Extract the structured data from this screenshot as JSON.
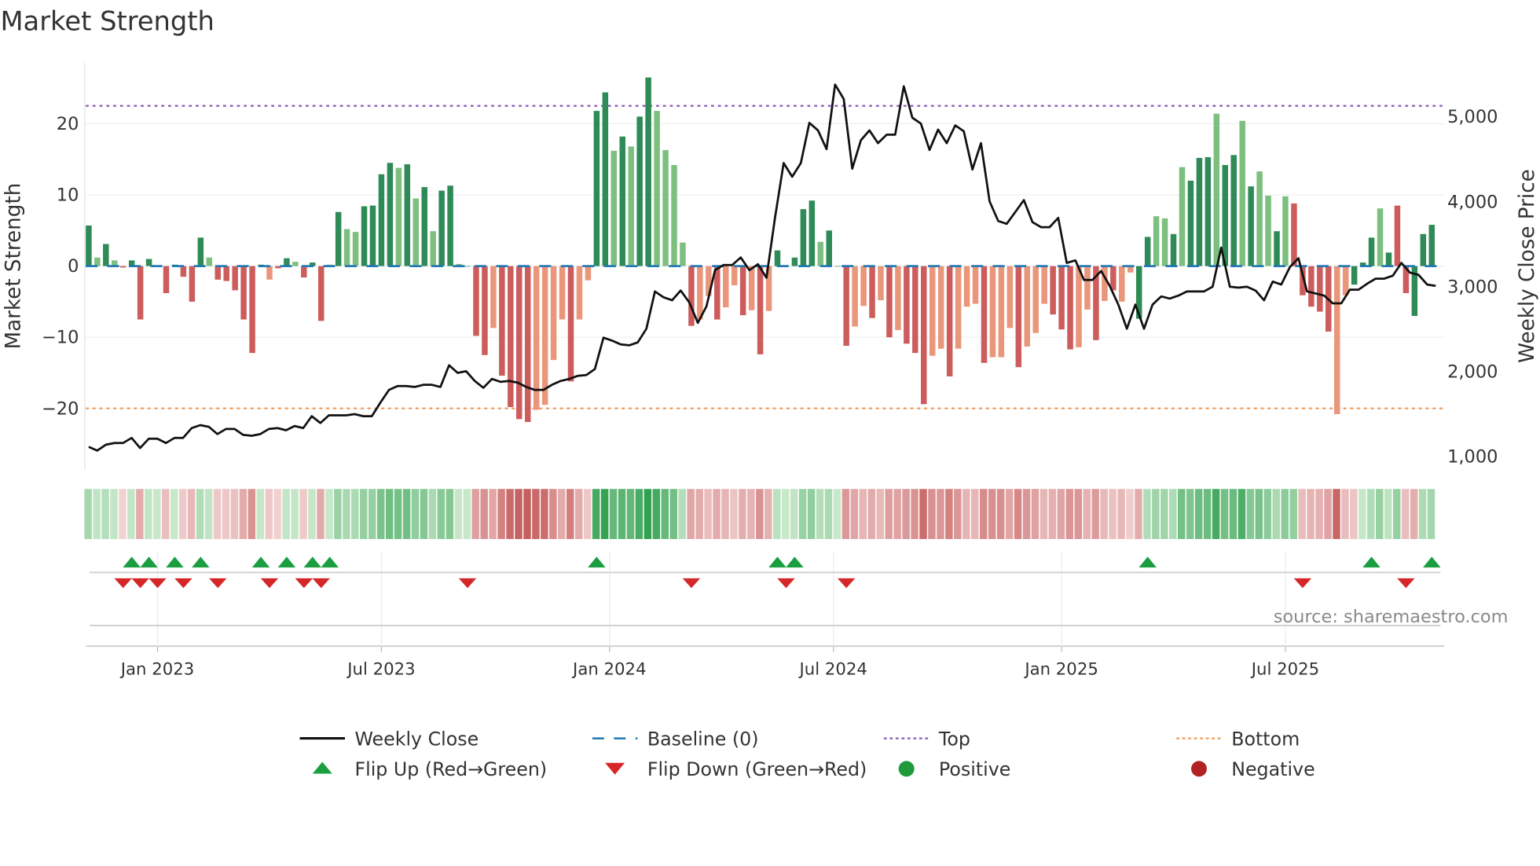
{
  "title": "Market Strength",
  "source": "source: sharemaestro.com",
  "colors": {
    "pos_strong": "#2e8b57",
    "pos_weak": "#7dbf7e",
    "neg_strong": "#cd5c5c",
    "neg_weak": "#e9967a",
    "top": "#9467bd",
    "bottom": "#f4a261",
    "baseline": "#1f77b4",
    "flip_up": "#1a9e3f",
    "flip_down": "#d62728",
    "line": "#111111"
  },
  "chart_data": {
    "type": "bar",
    "title": "Market Strength",
    "ylabel": "Market Strength",
    "y2label": "Weekly Close Price",
    "ylim": [
      -28,
      28
    ],
    "y2lim": [
      800,
      5700
    ],
    "yticks": [
      {
        "v": 20,
        "label": "20"
      },
      {
        "v": 10,
        "label": "10"
      },
      {
        "v": 0,
        "label": "0"
      },
      {
        "v": -10,
        "label": "−10"
      },
      {
        "v": -20,
        "label": "−20"
      }
    ],
    "y2ticks": [
      {
        "v": 5000,
        "label": "5,000"
      },
      {
        "v": 4000,
        "label": "4,000"
      },
      {
        "v": 3000,
        "label": "3,000"
      },
      {
        "v": 2000,
        "label": "2,000"
      },
      {
        "v": 1000,
        "label": "1,000"
      }
    ],
    "xticks": [
      {
        "week": 8,
        "label": "Jan 2023"
      },
      {
        "week": 34,
        "label": "Jul 2023"
      },
      {
        "week": 60.5,
        "label": "Jan 2024"
      },
      {
        "week": 86.5,
        "label": "Jul 2024"
      },
      {
        "week": 113,
        "label": "Jan 2025"
      },
      {
        "week": 139,
        "label": "Jul 2025"
      }
    ],
    "top_level": 22.5,
    "bottom_level": -20,
    "strength": [
      5.7,
      1.2,
      3.1,
      0.8,
      -0.2,
      0.8,
      -7.5,
      1.0,
      0,
      -3.8,
      0.2,
      -1.5,
      -5,
      4,
      1.2,
      -1.9,
      -2.1,
      -3.4,
      -7.5,
      -12.2,
      0.2,
      -1.9,
      -0.3,
      1.1,
      0.6,
      -1.6,
      0.5,
      -7.7,
      0.2,
      7.6,
      5.2,
      4.8,
      8.4,
      8.5,
      12.9,
      14.5,
      13.8,
      14.3,
      9.5,
      11.1,
      4.9,
      10.6,
      11.3,
      0.3,
      0,
      -9.8,
      -12.5,
      -8.7,
      -15.4,
      -19.8,
      -21.5,
      -21.9,
      -20.2,
      -19.5,
      -13.2,
      -7.5,
      -16.2,
      -7.5,
      -2,
      21.8,
      24.4,
      16.2,
      18.2,
      16.8,
      21,
      26.5,
      21.8,
      16.3,
      14.2,
      3.3,
      -8.4,
      -7.5,
      -4.2,
      -7.5,
      -5.8,
      -2.7,
      -6.9,
      -6.2,
      -12.4,
      -6.3,
      2.2,
      0,
      1.2,
      8,
      9.2,
      3.4,
      5,
      0,
      -11.2,
      -8.5,
      -5.6,
      -7.3,
      -4.8,
      -10,
      -9,
      -10.9,
      -12.2,
      -19.4,
      -12.6,
      -11.6,
      -15.5,
      -11.6,
      -5.7,
      -5.3,
      -13.6,
      -12.8,
      -12.8,
      -8.7,
      -14.2,
      -11.3,
      -9.4,
      -5.3,
      -6.8,
      -8.9,
      -11.7,
      -11.4,
      -6.1,
      -10.4,
      -4.9,
      -3.4,
      -5,
      -0.9,
      -7.4,
      4.1,
      7,
      6.7,
      4.5,
      13.9,
      12,
      15.2,
      15.3,
      21.4,
      14.2,
      15.6,
      20.4,
      11.2,
      13.3,
      9.9,
      4.9,
      9.8,
      8.8,
      -4.1,
      -5.7,
      -6.4,
      -9.2,
      -20.8,
      -4.1,
      -2.6,
      0.5,
      4,
      8.1,
      1.9,
      8.5,
      -3.8,
      -7,
      4.5,
      5.8
    ],
    "strength_shade": "GgGgRGRGGRGRRGgRRRRRGrRGgRGRgGggGGGGgGgGgGGgGRRrRRRRrrrrRrrGGgGgGGggggRrrRrrRrRrGGGGGgGGRrrRrRrRRRrrRrrrRrrrRrrrRRRrrRrRrrGGggGgGGGgGGgGggGgRRRRRrrGGGgGRRGG",
    "weekly_close": [
      1115,
      1070,
      1140,
      1160,
      1160,
      1220,
      1100,
      1210,
      1210,
      1160,
      1220,
      1220,
      1335,
      1370,
      1350,
      1265,
      1325,
      1325,
      1255,
      1245,
      1265,
      1325,
      1335,
      1310,
      1360,
      1335,
      1475,
      1395,
      1485,
      1485,
      1485,
      1500,
      1475,
      1475,
      1635,
      1785,
      1830,
      1830,
      1820,
      1845,
      1845,
      1820,
      2075,
      1985,
      2005,
      1890,
      1810,
      1915,
      1880,
      1890,
      1870,
      1820,
      1785,
      1785,
      1845,
      1890,
      1915,
      1950,
      1960,
      2030,
      2400,
      2365,
      2320,
      2310,
      2345,
      2505,
      2945,
      2875,
      2840,
      2955,
      2815,
      2575,
      2770,
      3195,
      3255,
      3255,
      3345,
      3195,
      3265,
      3105,
      3820,
      4455,
      4295,
      4455,
      4930,
      4840,
      4620,
      5380,
      5210,
      4390,
      4725,
      4840,
      4690,
      4790,
      4790,
      5360,
      4990,
      4920,
      4610,
      4850,
      4690,
      4900,
      4830,
      4380,
      4690,
      4005,
      3775,
      3740,
      3880,
      4020,
      3760,
      3700,
      3700,
      3810,
      3280,
      3310,
      3080,
      3080,
      3185,
      3010,
      2790,
      2505,
      2790,
      2505,
      2790,
      2885,
      2860,
      2895,
      2945,
      2945,
      2945,
      3000,
      3460,
      3000,
      2990,
      3000,
      2955,
      2840,
      3060,
      3025,
      3230,
      3335,
      2945,
      2920,
      2895,
      2805,
      2805,
      2965,
      2965,
      3035,
      3095,
      3095,
      3130,
      3280,
      3165,
      3140,
      3025,
      3010
    ],
    "flip_up_weeks": [
      5,
      7,
      10,
      13,
      20,
      23,
      26,
      28,
      59,
      80,
      82,
      123,
      149,
      156
    ],
    "flip_down_weeks": [
      4,
      6,
      8,
      11,
      15,
      21,
      25,
      27,
      44,
      70,
      81,
      88,
      141,
      153
    ],
    "legend": {
      "position": "bottom",
      "items": [
        {
          "label": "Weekly Close",
          "kind": "line"
        },
        {
          "label": "Baseline (0)",
          "kind": "dash"
        },
        {
          "label": "Top",
          "kind": "dot-top"
        },
        {
          "label": "Bottom",
          "kind": "dot-bottom"
        },
        {
          "label": "Flip Up (Red→Green)",
          "kind": "tri-up"
        },
        {
          "label": "Flip Down (Green→Red)",
          "kind": "tri-down"
        },
        {
          "label": "Positive",
          "kind": "circle-pos"
        },
        {
          "label": "Negative",
          "kind": "circle-neg"
        }
      ]
    }
  }
}
